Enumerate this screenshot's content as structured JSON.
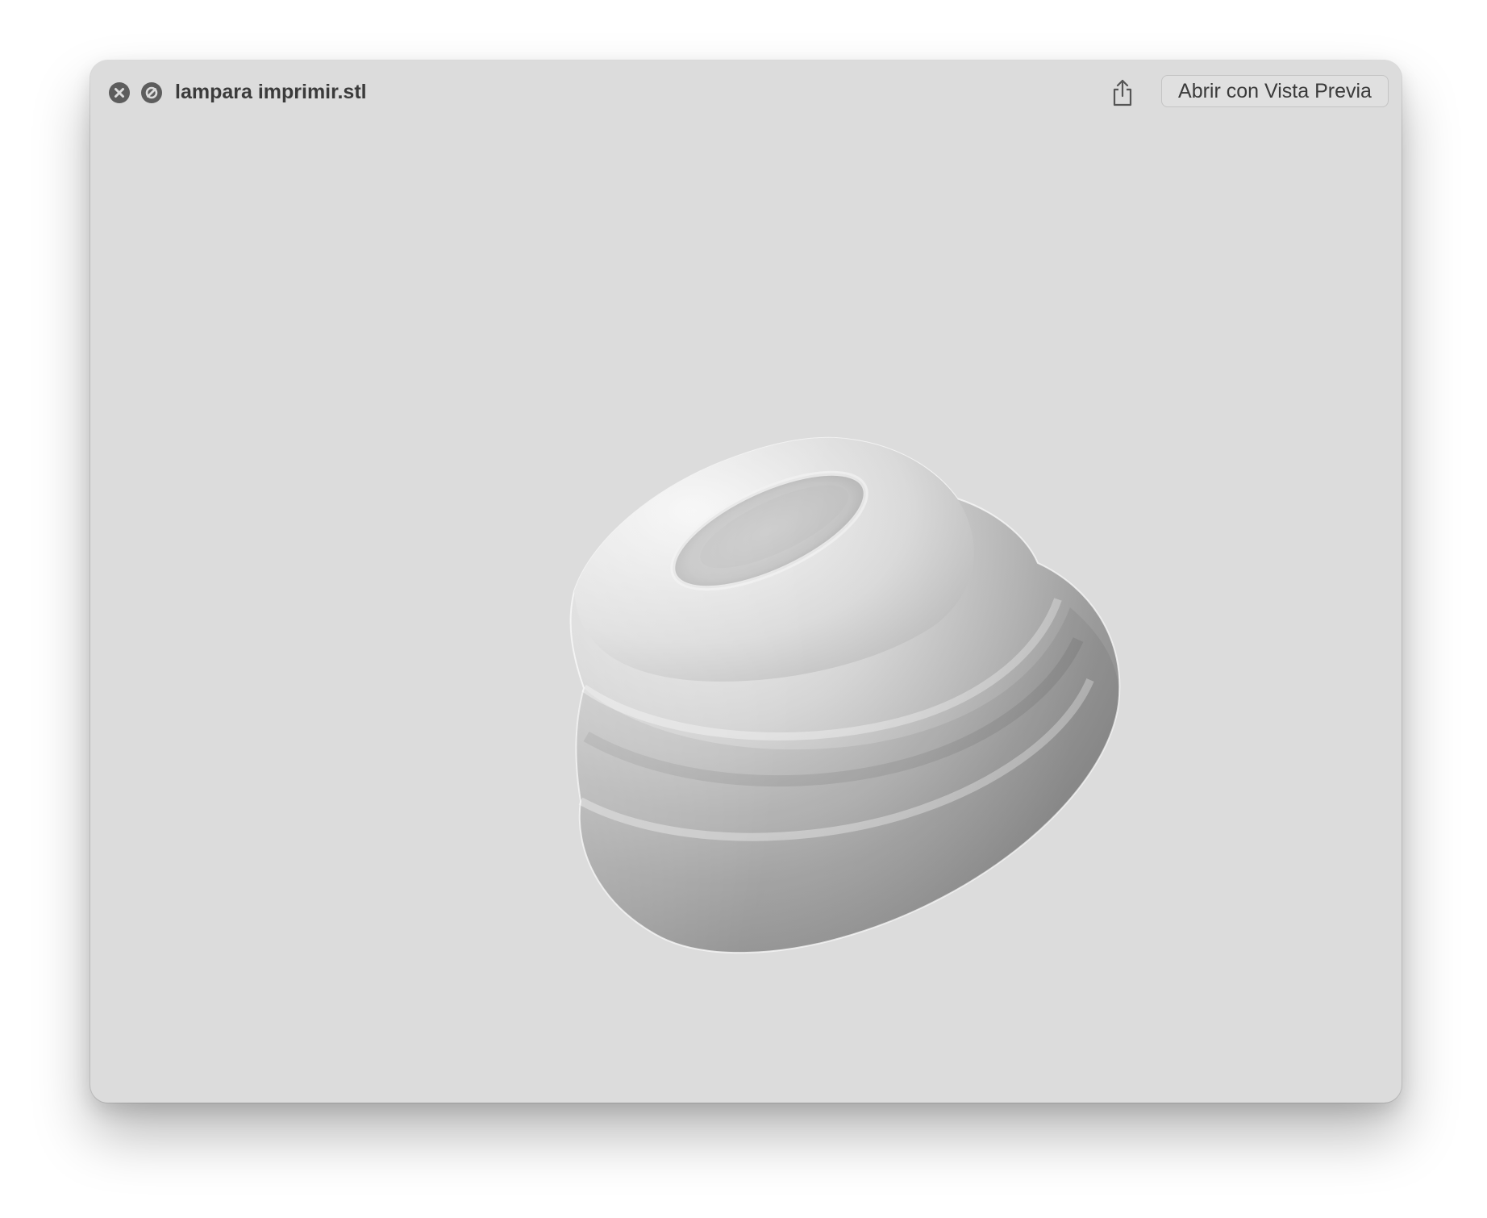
{
  "window": {
    "title": "lampara imprimir.stl",
    "background_color": "#dcdcdc"
  },
  "titlebar": {
    "close_icon": "close-circle-icon",
    "fullscreen_icon": "fullscreen-slash-icon",
    "share_icon": "share-icon",
    "open_with_label": "Abrir con Vista Previa"
  },
  "viewer": {
    "model": "3d-lamp-shade-model",
    "model_color": "#bdbdbd"
  }
}
